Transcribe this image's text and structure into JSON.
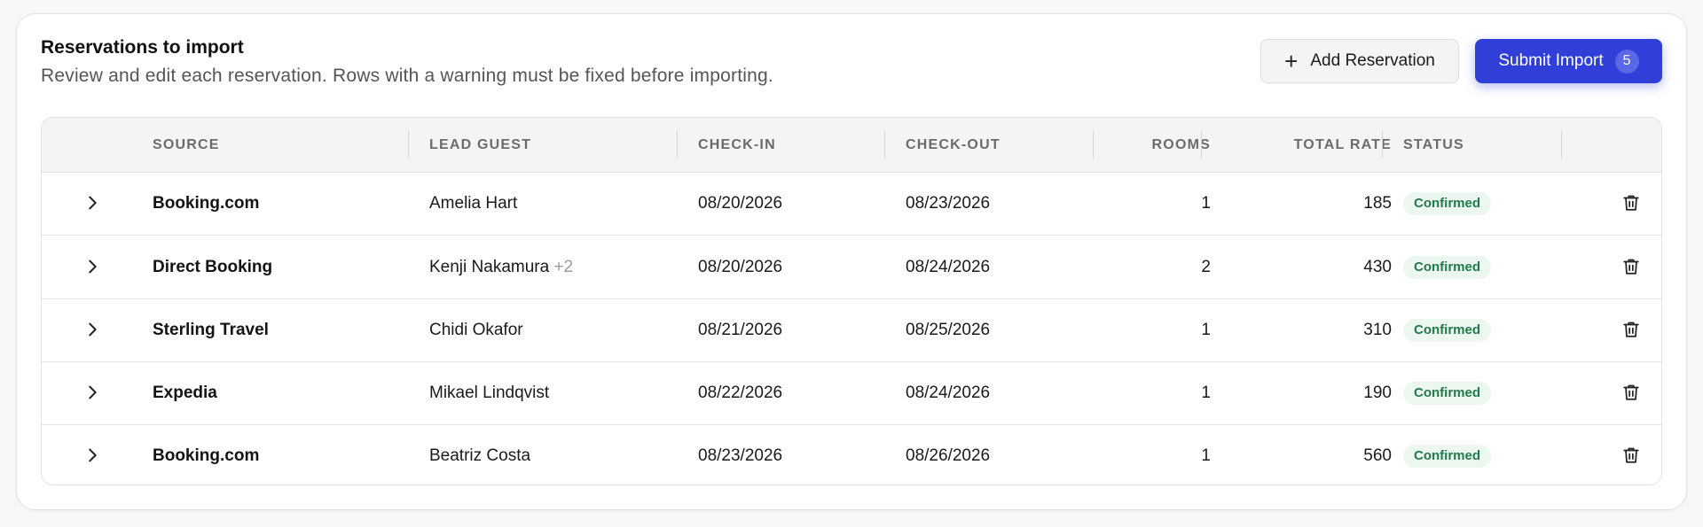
{
  "header": {
    "title": "Reservations to import",
    "subtitle": "Review and edit each reservation. Rows with a warning must be fixed before importing."
  },
  "actions": {
    "add_label": "Add Reservation",
    "submit_label": "Submit Import",
    "submit_count": "5"
  },
  "table": {
    "columns": {
      "source": "SOURCE",
      "lead_guest": "LEAD GUEST",
      "check_in": "CHECK-IN",
      "check_out": "CHECK-OUT",
      "rooms": "ROOMS",
      "total_rate": "TOTAL RATE",
      "status": "STATUS"
    },
    "rows": [
      {
        "source": "Booking.com",
        "guest": "Amelia Hart",
        "extra": "",
        "check_in": "08/20/2026",
        "check_out": "08/23/2026",
        "rooms": "1",
        "rate": "185",
        "status": "Confirmed"
      },
      {
        "source": "Direct Booking",
        "guest": "Kenji Nakamura",
        "extra": "+2",
        "check_in": "08/20/2026",
        "check_out": "08/24/2026",
        "rooms": "2",
        "rate": "430",
        "status": "Confirmed"
      },
      {
        "source": "Sterling Travel",
        "guest": "Chidi Okafor",
        "extra": "",
        "check_in": "08/21/2026",
        "check_out": "08/25/2026",
        "rooms": "1",
        "rate": "310",
        "status": "Confirmed"
      },
      {
        "source": "Expedia",
        "guest": "Mikael Lindqvist",
        "extra": "",
        "check_in": "08/22/2026",
        "check_out": "08/24/2026",
        "rooms": "1",
        "rate": "190",
        "status": "Confirmed"
      },
      {
        "source": "Booking.com",
        "guest": "Beatriz Costa",
        "extra": "",
        "check_in": "08/23/2026",
        "check_out": "08/26/2026",
        "rooms": "1",
        "rate": "560",
        "status": "Confirmed"
      }
    ]
  },
  "colors": {
    "primary": "#2f3fd8",
    "status_bg": "#ecf7f0",
    "status_text": "#217a4a"
  },
  "icons": {
    "add": "plus-icon",
    "expand": "chevron-right-icon",
    "delete": "trash-icon"
  }
}
